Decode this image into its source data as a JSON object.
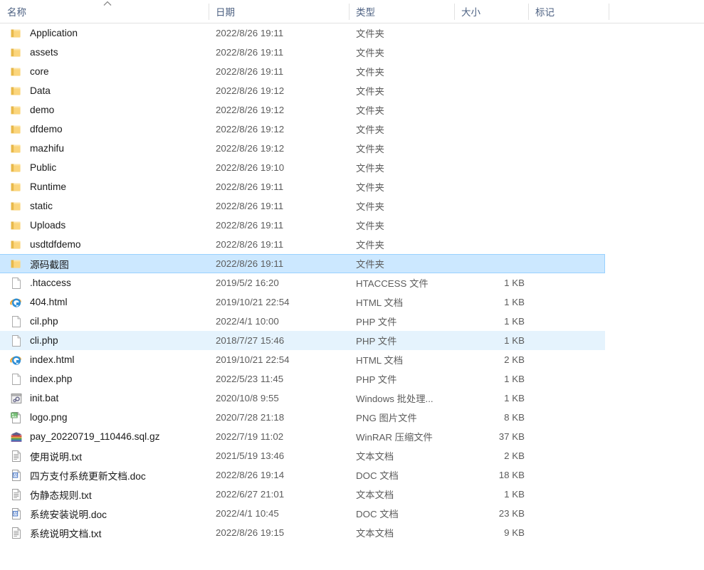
{
  "columns": [
    {
      "key": "name",
      "label": "名称",
      "sort": "asc"
    },
    {
      "key": "date",
      "label": "日期"
    },
    {
      "key": "type",
      "label": "类型"
    },
    {
      "key": "size",
      "label": "大小"
    },
    {
      "key": "tags",
      "label": "标记"
    }
  ],
  "colors": {
    "selection_fill": "#cce8ff",
    "selection_border": "#99d1ff",
    "hover_fill": "#e5f3fd",
    "header_text": "#4d6182",
    "row_text": "#1a1a1a",
    "secondary_text": "#5c5c5c",
    "folder_icon": "#f5c75d",
    "divider": "#e2e2e2"
  },
  "rows": [
    {
      "name": "Application",
      "date": "2022/8/26 19:11",
      "type": "文件夹",
      "size": "",
      "tags": "",
      "icon": "folder-icon",
      "state": "normal"
    },
    {
      "name": "assets",
      "date": "2022/8/26 19:11",
      "type": "文件夹",
      "size": "",
      "tags": "",
      "icon": "folder-icon",
      "state": "normal"
    },
    {
      "name": "core",
      "date": "2022/8/26 19:11",
      "type": "文件夹",
      "size": "",
      "tags": "",
      "icon": "folder-icon",
      "state": "normal"
    },
    {
      "name": "Data",
      "date": "2022/8/26 19:12",
      "type": "文件夹",
      "size": "",
      "tags": "",
      "icon": "folder-icon",
      "state": "normal"
    },
    {
      "name": "demo",
      "date": "2022/8/26 19:12",
      "type": "文件夹",
      "size": "",
      "tags": "",
      "icon": "folder-icon",
      "state": "normal"
    },
    {
      "name": "dfdemo",
      "date": "2022/8/26 19:12",
      "type": "文件夹",
      "size": "",
      "tags": "",
      "icon": "folder-icon",
      "state": "normal"
    },
    {
      "name": "mazhifu",
      "date": "2022/8/26 19:12",
      "type": "文件夹",
      "size": "",
      "tags": "",
      "icon": "folder-icon",
      "state": "normal"
    },
    {
      "name": "Public",
      "date": "2022/8/26 19:10",
      "type": "文件夹",
      "size": "",
      "tags": "",
      "icon": "folder-icon",
      "state": "normal"
    },
    {
      "name": "Runtime",
      "date": "2022/8/26 19:11",
      "type": "文件夹",
      "size": "",
      "tags": "",
      "icon": "folder-icon",
      "state": "normal"
    },
    {
      "name": "static",
      "date": "2022/8/26 19:11",
      "type": "文件夹",
      "size": "",
      "tags": "",
      "icon": "folder-icon",
      "state": "normal"
    },
    {
      "name": "Uploads",
      "date": "2022/8/26 19:11",
      "type": "文件夹",
      "size": "",
      "tags": "",
      "icon": "folder-icon",
      "state": "normal"
    },
    {
      "name": "usdtdfdemo",
      "date": "2022/8/26 19:11",
      "type": "文件夹",
      "size": "",
      "tags": "",
      "icon": "folder-icon",
      "state": "normal"
    },
    {
      "name": "源码截图",
      "date": "2022/8/26 19:11",
      "type": "文件夹",
      "size": "",
      "tags": "",
      "icon": "folder-icon",
      "state": "selected"
    },
    {
      "name": ".htaccess",
      "date": "2019/5/2 16:20",
      "type": "HTACCESS 文件",
      "size": "1 KB",
      "tags": "",
      "icon": "blank-file-icon",
      "state": "normal"
    },
    {
      "name": "404.html",
      "date": "2019/10/21 22:54",
      "type": "HTML 文档",
      "size": "1 KB",
      "tags": "",
      "icon": "internet-explorer-icon",
      "state": "normal"
    },
    {
      "name": "cil.php",
      "date": "2022/4/1 10:00",
      "type": "PHP 文件",
      "size": "1 KB",
      "tags": "",
      "icon": "blank-file-icon",
      "state": "normal"
    },
    {
      "name": "cli.php",
      "date": "2018/7/27 15:46",
      "type": "PHP 文件",
      "size": "1 KB",
      "tags": "",
      "icon": "blank-file-icon",
      "state": "hover"
    },
    {
      "name": "index.html",
      "date": "2019/10/21 22:54",
      "type": "HTML 文档",
      "size": "2 KB",
      "tags": "",
      "icon": "internet-explorer-icon",
      "state": "normal"
    },
    {
      "name": "index.php",
      "date": "2022/5/23 11:45",
      "type": "PHP 文件",
      "size": "1 KB",
      "tags": "",
      "icon": "blank-file-icon",
      "state": "normal"
    },
    {
      "name": "init.bat",
      "date": "2020/10/8 9:55",
      "type": "Windows 批处理...",
      "size": "1 KB",
      "tags": "",
      "icon": "batch-file-icon",
      "state": "normal"
    },
    {
      "name": "logo.png",
      "date": "2020/7/28 21:18",
      "type": "PNG 图片文件",
      "size": "8 KB",
      "tags": "",
      "icon": "image-file-icon",
      "state": "normal"
    },
    {
      "name": "pay_20220719_110446.sql.gz",
      "date": "2022/7/19 11:02",
      "type": "WinRAR 压缩文件",
      "size": "37 KB",
      "tags": "",
      "icon": "winrar-archive-icon",
      "state": "normal"
    },
    {
      "name": "使用说明.txt",
      "date": "2021/5/19 13:46",
      "type": "文本文档",
      "size": "2 KB",
      "tags": "",
      "icon": "text-file-icon",
      "state": "normal"
    },
    {
      "name": "四方支付系统更新文档.doc",
      "date": "2022/8/26 19:14",
      "type": "DOC 文档",
      "size": "18 KB",
      "tags": "",
      "icon": "word-doc-icon",
      "state": "normal"
    },
    {
      "name": "伪静态规则.txt",
      "date": "2022/6/27 21:01",
      "type": "文本文档",
      "size": "1 KB",
      "tags": "",
      "icon": "text-file-icon",
      "state": "normal"
    },
    {
      "name": "系统安装说明.doc",
      "date": "2022/4/1 10:45",
      "type": "DOC 文档",
      "size": "23 KB",
      "tags": "",
      "icon": "word-doc-icon",
      "state": "normal"
    },
    {
      "name": "系统说明文档.txt",
      "date": "2022/8/26 19:15",
      "type": "文本文档",
      "size": "9 KB",
      "tags": "",
      "icon": "text-file-icon",
      "state": "normal"
    }
  ]
}
